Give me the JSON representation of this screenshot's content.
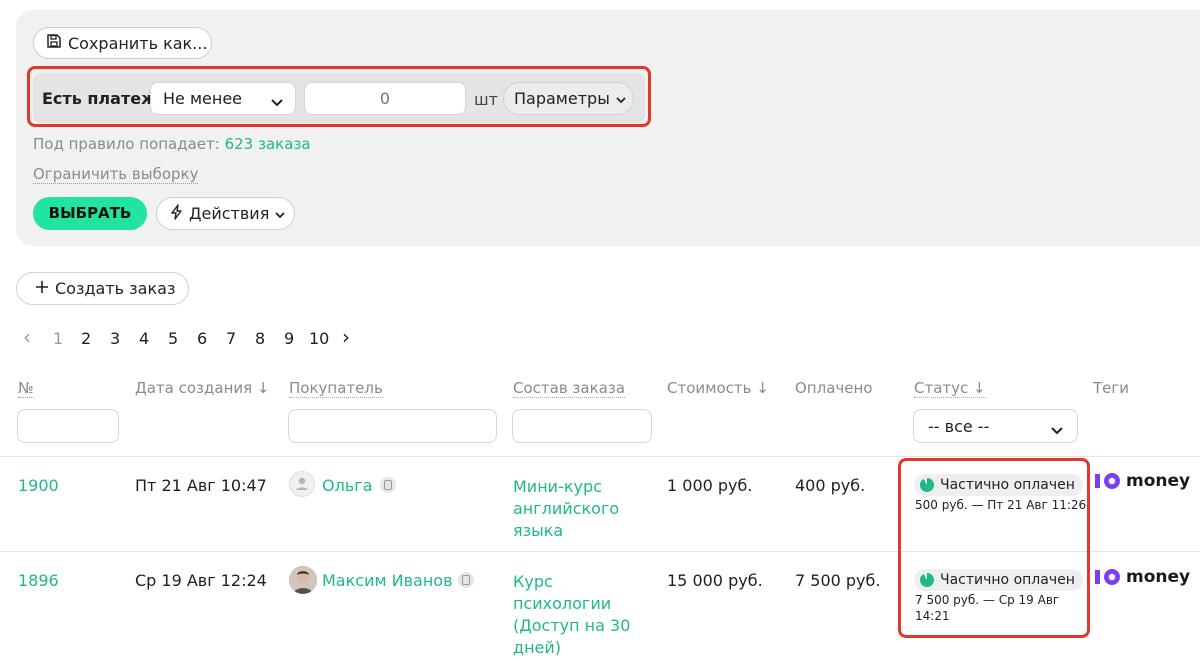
{
  "filter": {
    "save_label": "Сохранить как...",
    "rule_label": "Есть платеж",
    "operator_value": "Не менее",
    "amount_placeholder": "0",
    "unit_label": "шт",
    "params_label": "Параметры",
    "match_prefix": "Под правило попадает:",
    "match_count": "623 заказа",
    "limit_label": "Ограничить выборку",
    "select_button": "ВЫБРАТЬ",
    "actions_label": "Действия"
  },
  "create_order_label": "Создать заказ",
  "pagination": {
    "prev": "‹",
    "pages": [
      "1",
      "2",
      "3",
      "4",
      "5",
      "6",
      "7",
      "8",
      "9",
      "10"
    ],
    "next": "›",
    "current": "1"
  },
  "table": {
    "columns": {
      "number": "№",
      "created": "Дата создания ↓",
      "buyer": "Покупатель",
      "composition": "Состав заказа",
      "cost": "Стоимость ↓",
      "paid": "Оплачено",
      "status": "Статус ↓",
      "tags": "Теги"
    },
    "status_filter_value": "-- все --",
    "rows": [
      {
        "id": "1900",
        "date": "Пт 21 Авг 10:47",
        "buyer": "Ольга",
        "composition": [
          "Мини-курс",
          "английского",
          "языка"
        ],
        "cost": "1 000 руб.",
        "paid": "400 руб.",
        "status": "Частично оплачен",
        "status_detail": [
          "500 руб. — Пт 21 Авг 11:26"
        ],
        "tag": "money"
      },
      {
        "id": "1896",
        "date": "Ср 19 Авг 12:24",
        "buyer": "Максим Иванов",
        "composition": [
          "Курс",
          "психологии",
          "(Доступ на 30",
          "дней)"
        ],
        "cost": "15 000 руб.",
        "paid": "7 500 руб.",
        "status": "Частично оплачен",
        "status_detail": [
          "7 500 руб. — Ср 19 Авг",
          "14:21"
        ],
        "tag": "money"
      }
    ]
  },
  "colors": {
    "accent_green": "#1fb889",
    "bright_green": "#21e4a0",
    "highlight_red": "#e0392b",
    "panel_bg": "#f1f1f1"
  }
}
